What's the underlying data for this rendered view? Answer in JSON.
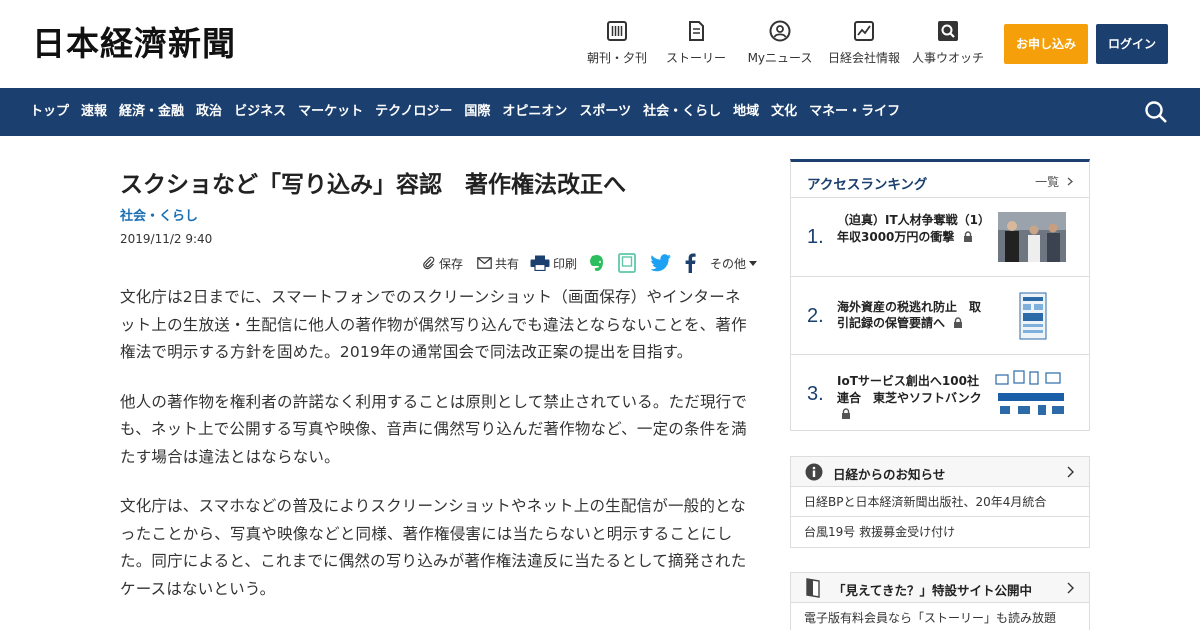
{
  "header": {
    "logo": "日本経濟新聞",
    "nav": [
      {
        "label": "朝刊・夕刊",
        "icon": "newspaper-icon"
      },
      {
        "label": "ストーリー",
        "icon": "document-icon"
      },
      {
        "label": "Myニュース",
        "icon": "user-icon"
      },
      {
        "label": "日経会社情報",
        "icon": "chart-icon"
      },
      {
        "label": "人事ウオッチ",
        "icon": "person-search-icon"
      }
    ],
    "apply_label": "お申し込み",
    "login_label": "ログイン"
  },
  "gnav": {
    "items": [
      "トップ",
      "速報",
      "経済・金融",
      "政治",
      "ビジネス",
      "マーケット",
      "テクノロジー",
      "国際",
      "オピニオン",
      "スポーツ",
      "社会・くらし",
      "地域",
      "文化",
      "マネー・ライフ"
    ]
  },
  "article": {
    "title": "スクショなど「写り込み」容認　著作権法改正へ",
    "category": "社会・くらし",
    "date": "2019/11/2 9:40",
    "share": {
      "save": "保存",
      "share": "共有",
      "print": "印刷",
      "more": "その他"
    },
    "paragraphs": [
      "文化庁は2日までに、スマートフォンでのスクリーンショット（画面保存）やインターネット上の生放送・生配信に他人の著作物が偶然写り込んでも違法とならないことを、著作権法で明示する方針を固めた。2019年の通常国会で同法改正案の提出を目指す。",
      "他人の著作物を権利者の許諾なく利用することは原則として禁止されている。ただ現行でも、ネット上で公開する写真や映像、音声に偶然写り込んだ著作物など、一定の条件を満たす場合は違法とはならない。",
      "文化庁は、スマホなどの普及によりスクリーンショットやネット上の生配信が一般的となったことから、写真や映像などと同様、著作権侵害には当たらないと明示することにした。同庁によると、これまでに偶然の写り込みが著作権法違反に当たるとして摘発されたケースはないという。"
    ]
  },
  "sidebar": {
    "ranking": {
      "title": "アクセスランキング",
      "more": "一覧",
      "items": [
        {
          "num": "1.",
          "text": "（迫真）IT人材争奪戦（1）　年収3000万円の衝撃"
        },
        {
          "num": "2.",
          "text": "海外資産の税逃れ防止　取引記録の保管要請へ"
        },
        {
          "num": "3.",
          "text": "IoTサービス創出へ100社連合　東芝やソフトバンク"
        }
      ]
    },
    "notice": {
      "title": "日経からのお知らせ",
      "items": [
        "日経BPと日本経済新聞出版社、20年4月統合",
        "台風19号 救援募金受け付け"
      ]
    },
    "promo": {
      "title": "「見えてきた？」特設サイト公開中",
      "text": "電子版有料会員なら「ストーリー」も読み放題"
    }
  },
  "colors": {
    "brand_navy": "#1b3f6e",
    "apply_orange": "#f5a00a",
    "category_blue": "#1a6fb3"
  }
}
